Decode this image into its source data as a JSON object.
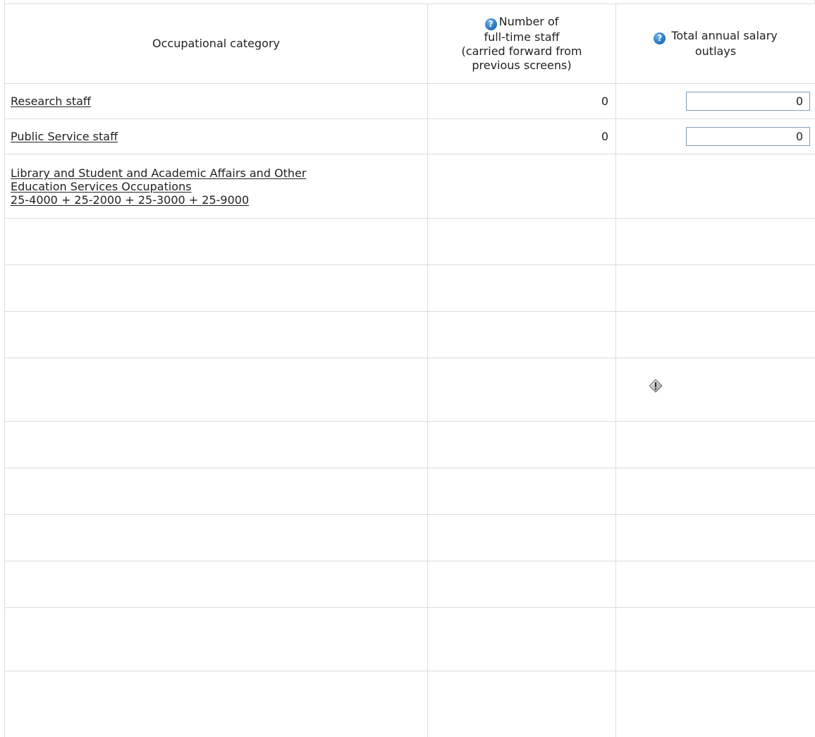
{
  "table": {
    "headers": {
      "category": "Occupational category",
      "fulltime_lines": [
        "Number of",
        "full-time staff",
        "(carried forward from",
        "previous screens)"
      ],
      "salary_lines": [
        "Total annual salary",
        "outlays"
      ],
      "help_icon": "question-mark-help-icon"
    },
    "rows": [
      {
        "category_lines": [
          "Research staff"
        ],
        "fulltime": "0",
        "salary": "0"
      },
      {
        "category_lines": [
          "Public Service staff"
        ],
        "fulltime": "0",
        "salary": "0"
      },
      {
        "category_lines": [
          "Library and Student and Academic Affairs and Other",
          "Education Services Occupations",
          "25-4000 + 25-2000 + 25-3000 + 25-9000"
        ],
        "fulltime": "",
        "salary": ""
      }
    ],
    "warning_icon": "warning-diamond-icon"
  },
  "colors": {
    "border": "#dcdcdc",
    "input_border": "#7f9db9",
    "help_icon_blue": "#2f7cc6"
  }
}
